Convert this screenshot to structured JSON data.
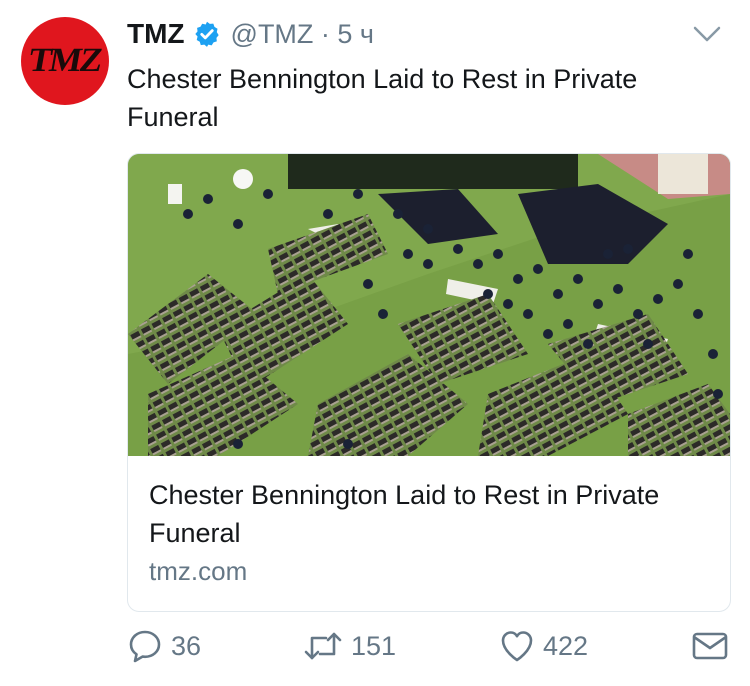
{
  "avatar": {
    "logo_text": "TMZ"
  },
  "header": {
    "name": "TMZ",
    "handle": "@TMZ · 5 ч"
  },
  "tweet": {
    "text": "Chester Bennington Laid to Rest in Private Funeral"
  },
  "card": {
    "title": "Chester Bennington Laid to Rest in Private Funeral",
    "domain": "tmz.com"
  },
  "actions": {
    "replies": "36",
    "retweets": "151",
    "likes": "422"
  },
  "colors": {
    "verified": "#1da1f2",
    "secondary_text": "#657786",
    "brand": "#e0161e"
  },
  "icons": {
    "verified": "verified-badge-icon",
    "caret": "chevron-down-icon",
    "reply": "reply-bubble-icon",
    "retweet": "retweet-icon",
    "like": "heart-icon",
    "dm": "envelope-icon"
  }
}
